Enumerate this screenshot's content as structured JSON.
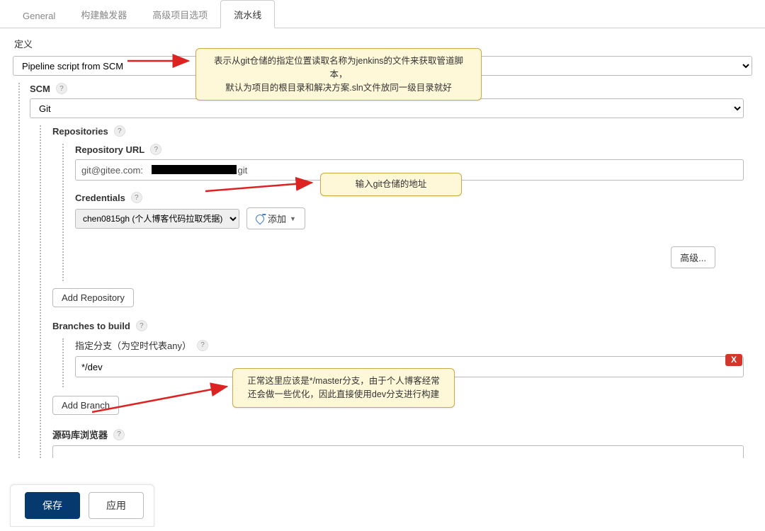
{
  "tabs": [
    "General",
    "构建触发器",
    "高级项目选项",
    "流水线"
  ],
  "active_tab": "流水线",
  "definition": {
    "label": "定义",
    "value": "Pipeline script from SCM"
  },
  "scm": {
    "label": "SCM",
    "value": "Git"
  },
  "repositories": {
    "label": "Repositories",
    "url_label": "Repository URL",
    "url_value": "git@gitee.com:██████████████.git",
    "credentials_label": "Credentials",
    "credentials_value": "chen0815gh (个人博客代码拉取凭据)",
    "add_btn": "添加",
    "advanced_btn": "高级...",
    "add_repo_btn": "Add Repository"
  },
  "branches": {
    "label": "Branches to build",
    "specifier_label": "指定分支（为空时代表any）",
    "specifier_value": "*/dev",
    "delete_btn": "X",
    "add_branch_btn": "Add Branch"
  },
  "source_browser_label": "源码库浏览器",
  "footer": {
    "save": "保存",
    "apply": "应用"
  },
  "callouts": {
    "c1": "表示从git仓储的指定位置读取名称为jenkins的文件来获取管道脚本，\n默认为项目的根目录和解决方案.sln文件放同一级目录就好",
    "c2": "输入git仓储的地址",
    "c3": "正常这里应该是*/master分支，由于个人博客经常\n还会做一些优化，因此直接使用dev分支进行构建"
  }
}
